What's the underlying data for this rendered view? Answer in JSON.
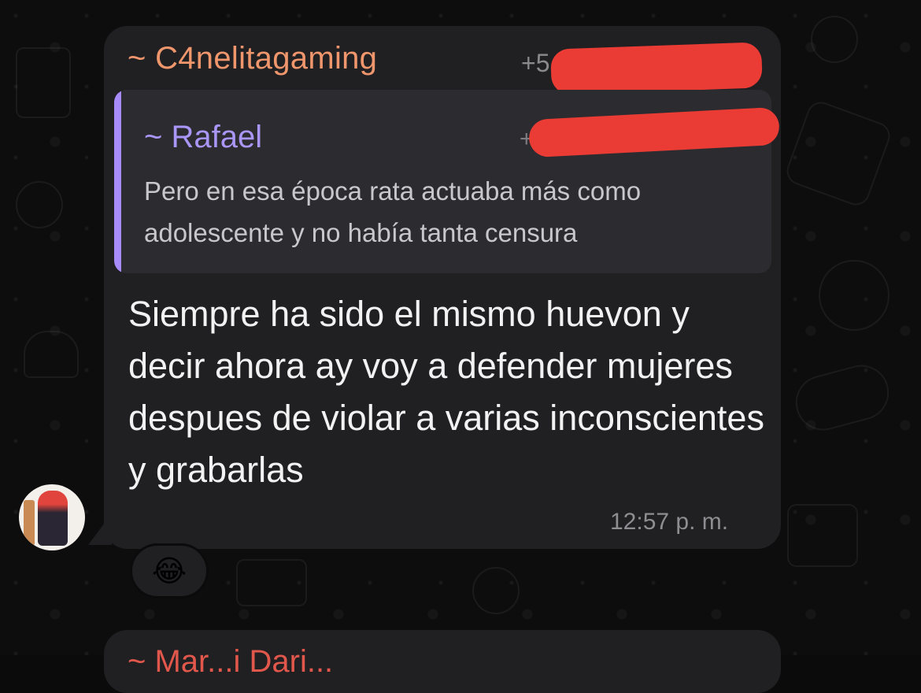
{
  "message": {
    "sender_name": "~ C4nelitagaming",
    "sender_phone": "+5",
    "text": "Siempre ha sido el mismo huevon y decir ahora ay voy a defender mujeres despues de violar a varias inconscientes y grabarlas",
    "time": "12:57 p. m.",
    "sender_color": "#f0966c"
  },
  "quote": {
    "name": "~ Rafael",
    "phone": "+",
    "text": "Pero en esa época rata actuaba más como adolescente y no había tanta censura",
    "accent_color": "#a78bfa"
  },
  "reaction": {
    "emoji": "😂"
  },
  "next_message": {
    "sender_name": "~ Mar...i Dari..."
  },
  "redaction_color": "#ea3b34",
  "avatar_icon": "avatar-photo"
}
